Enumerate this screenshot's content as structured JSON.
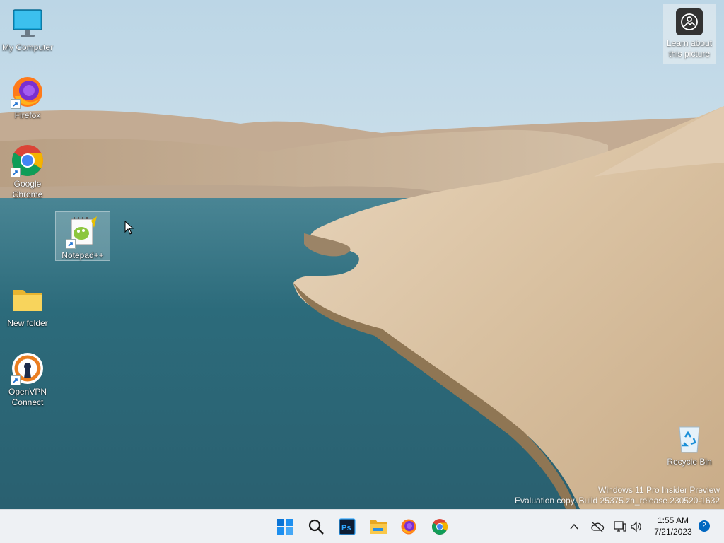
{
  "desktop_icons": {
    "my_computer": "My Computer",
    "firefox": "Firefox",
    "chrome": "Google\nChrome",
    "notepadpp": "Notepad++",
    "new_folder": "New folder",
    "openvpn": "OpenVPN\nConnect",
    "recycle_bin": "Recycle Bin"
  },
  "learn_picture": {
    "line1": "Learn about",
    "line2": "this picture"
  },
  "watermark": {
    "line1": "Windows 11 Pro Insider Preview",
    "line2": "Evaluation copy. Build 25375.zn_release.230520-1632"
  },
  "taskbar": {
    "apps": [
      "start-icon",
      "search-icon",
      "photoshop-icon",
      "file-explorer-icon",
      "firefox-icon",
      "chrome-icon"
    ],
    "tray": [
      "chevron-up-icon",
      "cloud-off-icon",
      "network-icon",
      "volume-icon"
    ],
    "time": "1:55 AM",
    "date": "7/21/2023",
    "notifications": "2"
  },
  "colors": {
    "taskbar_bg": "#eef1f4",
    "accent": "#0067c0"
  }
}
